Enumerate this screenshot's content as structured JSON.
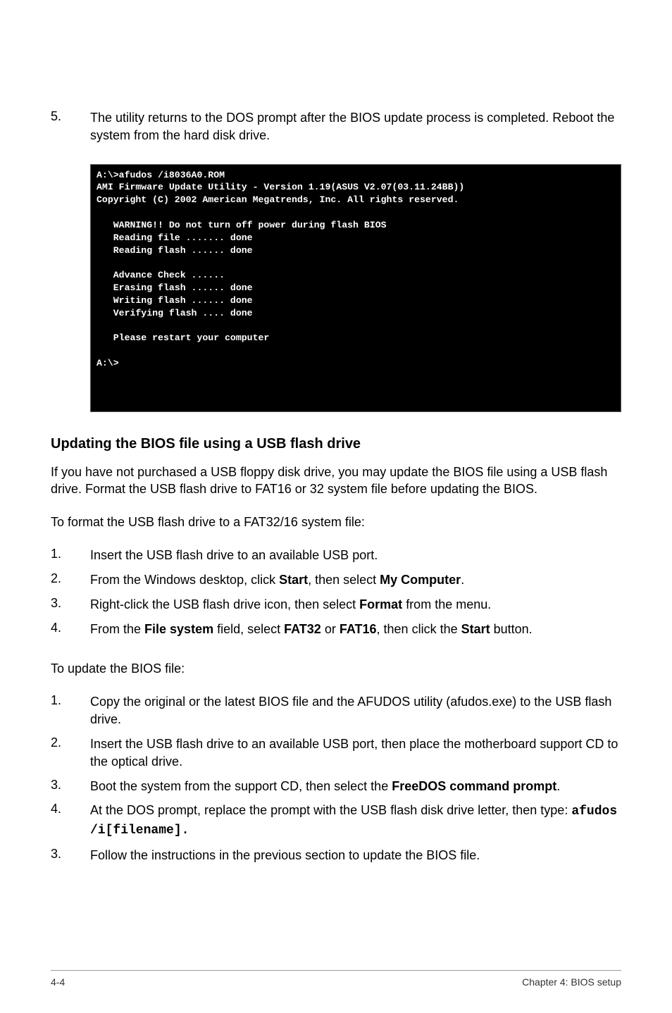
{
  "step5": {
    "num": "5.",
    "text": "The utility returns to the DOS prompt after the BIOS update process is completed. Reboot the system from the hard disk drive."
  },
  "terminal": "A:\\>afudos /i8036A0.ROM\nAMI Firmware Update Utility - Version 1.19(ASUS V2.07(03.11.24BB))\nCopyright (C) 2002 American Megatrends, Inc. All rights reserved.\n\n   WARNING!! Do not turn off power during flash BIOS\n   Reading file ....... done\n   Reading flash ...... done\n\n   Advance Check ......\n   Erasing flash ...... done\n   Writing flash ...... done\n   Verifying flash .... done\n\n   Please restart your computer\n\nA:\\>",
  "heading": "Updating the BIOS file using a USB flash drive",
  "intro": "If you have not purchased a USB floppy disk drive, you may  update the BIOS file using a USB flash drive. Format the USB flash drive to FAT16 or 32 system file before updating the BIOS.",
  "format_lead": "To format the USB flash drive to a FAT32/16 system file:",
  "format_steps": [
    {
      "num": "1.",
      "html": "Insert the USB flash drive to an available USB port."
    },
    {
      "num": "2.",
      "html": "From the Windows desktop, click <strong>Start</strong>, then select <strong>My Computer</strong>."
    },
    {
      "num": "3.",
      "html": "Right-click the USB flash drive icon, then select <strong>Format</strong> from the menu."
    },
    {
      "num": "4.",
      "html": "From the <strong>File system</strong> field, select <strong>FAT32</strong> or <strong>FAT16</strong>, then click the <strong>Start</strong> button."
    }
  ],
  "update_lead": "To update the BIOS file:",
  "update_steps": [
    {
      "num": "1.",
      "html": "Copy the original or the latest BIOS file and the AFUDOS utility  (afudos.exe) to the USB flash drive."
    },
    {
      "num": "2.",
      "html": "Insert the USB flash drive to an available USB port, then place the motherboard support CD to the optical drive."
    },
    {
      "num": "3.",
      "html": "Boot the system from the support CD, then select the <strong>FreeDOS command prompt</strong>."
    },
    {
      "num": "4.",
      "html": "At the DOS prompt, replace the prompt with the USB flash disk drive letter, then type: <span class=\"mono\">afudos /i[filename].</span>"
    },
    {
      "num": "3.",
      "html": "Follow the instructions in the previous section to update the BIOS file."
    }
  ],
  "footer": {
    "left": "4-4",
    "right": "Chapter 4: BIOS setup"
  }
}
